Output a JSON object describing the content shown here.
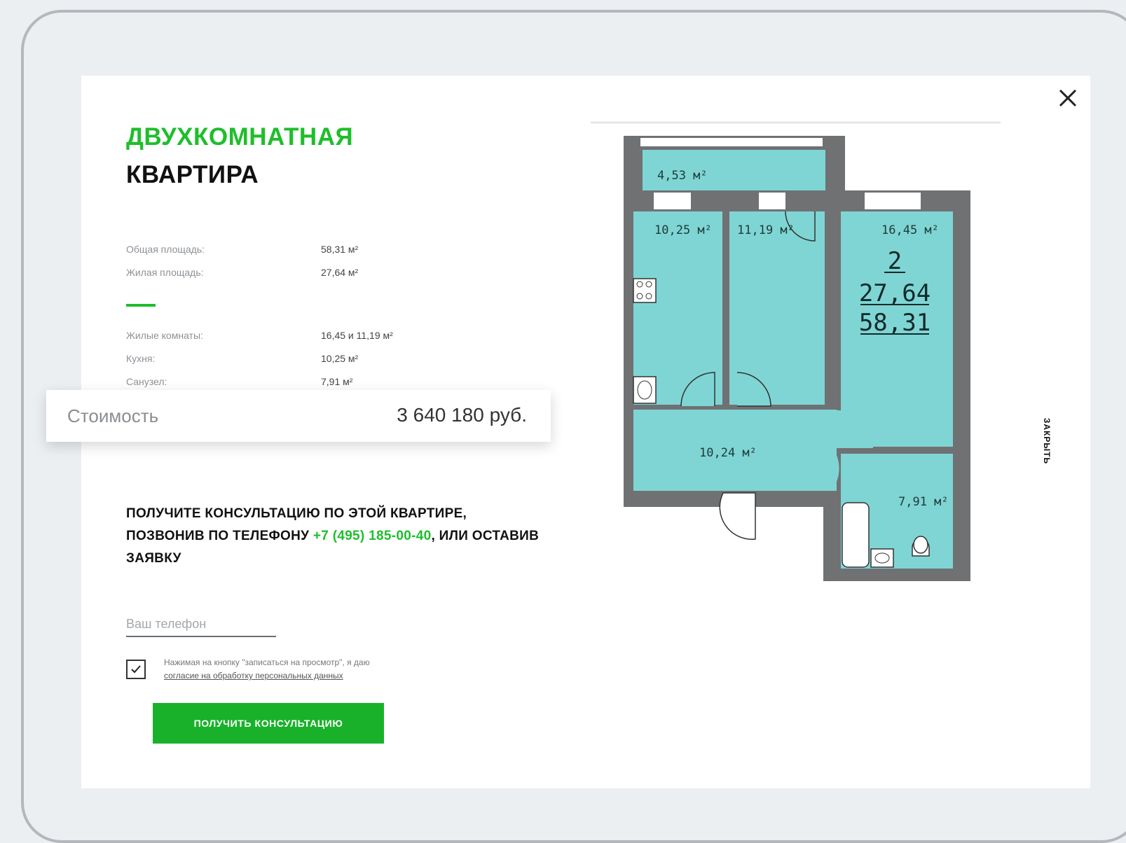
{
  "modal": {
    "close_label": "ЗАКРЫТЬ",
    "title_line1": "ДВУХКОМНАТНАЯ",
    "title_line2": "КВАРТИРА"
  },
  "specs": [
    {
      "label": "Общая площадь:",
      "value": "58,31 м²"
    },
    {
      "label": "Жилая площадь:",
      "value": "27,64 м²"
    },
    {
      "label": "Жилые комнаты:",
      "value": "16,45 и 11,19 м²"
    },
    {
      "label": "Кухня:",
      "value": "10,25 м²"
    },
    {
      "label": "Санузел:",
      "value": "7,91 м²"
    }
  ],
  "price": {
    "label": "Стоимость",
    "value": "3 640 180 руб."
  },
  "consult": {
    "text_before": "ПОЛУЧИТЕ КОНСУЛЬТАЦИЮ ПО ЭТОЙ КВАРТИРЕ, ПОЗВОНИВ ПО ТЕЛЕФОНУ ",
    "phone": "+7 (495) 185-00-40",
    "text_after": ", ИЛИ ОСТАВИВ ЗАЯВКУ"
  },
  "form": {
    "phone_placeholder": "Ваш телефон",
    "consent_text": "Нажимая на кнопку \"записаться на просмотр\", я даю",
    "consent_link": "согласие на обработку персональных данных",
    "checked": true,
    "submit_label": "ПОЛУЧИТЬ КОНСУЛЬТАЦИЮ"
  },
  "plan": {
    "rooms": {
      "balcony": "4,53 м²",
      "kitchen": "10,25 м²",
      "room_middle": "11,19 м²",
      "room_right": "16,45 м²",
      "hall": "10,24 м²",
      "bath": "7,91 м²"
    },
    "summary": {
      "rooms_count": "2",
      "living_area": "27,64",
      "total_area": "58,31"
    },
    "colors": {
      "room_fill": "#7fd5d4",
      "wall": "#6f7173",
      "accent_green": "#1fbe2b"
    }
  }
}
